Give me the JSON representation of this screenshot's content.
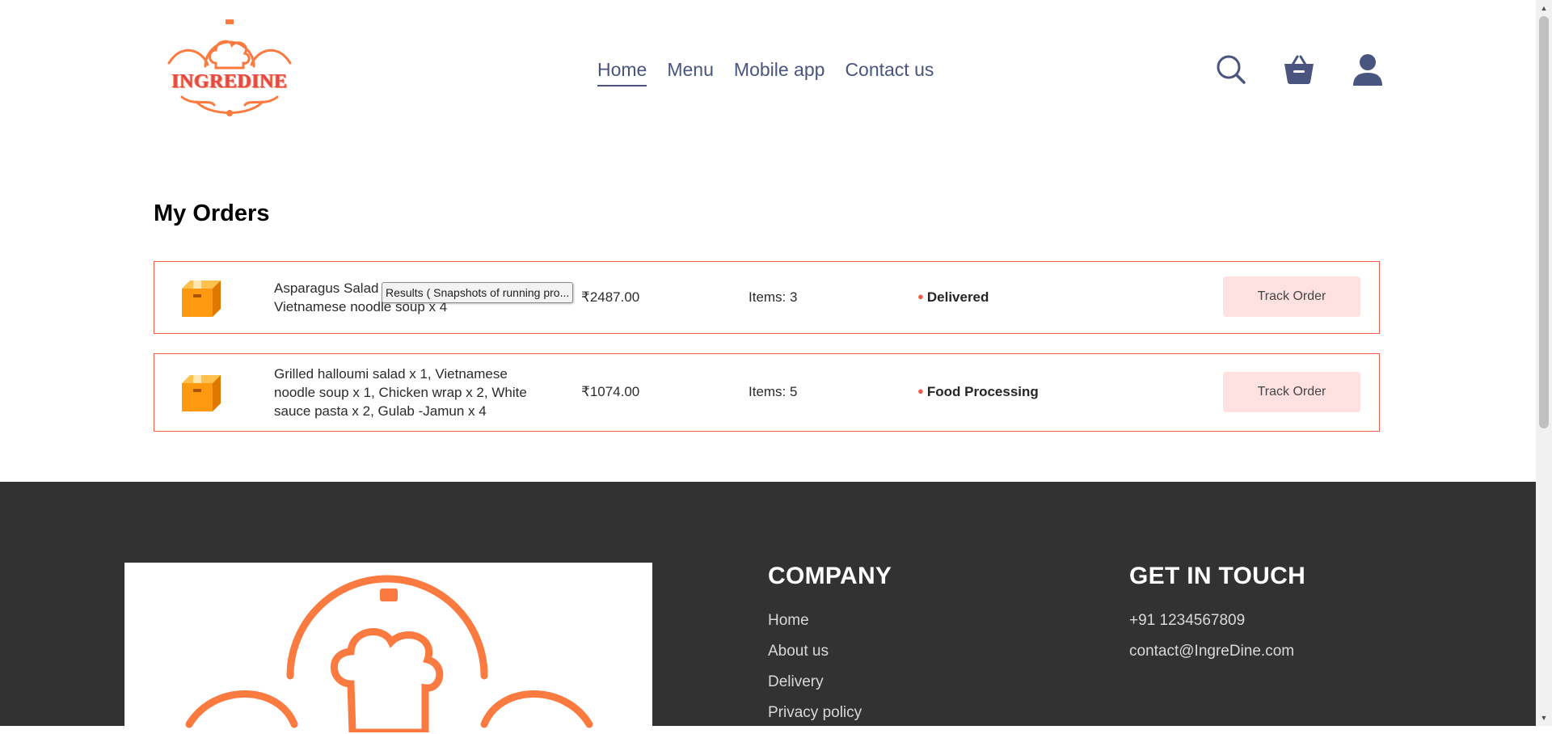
{
  "brand": {
    "logo_text": "INGREDINE"
  },
  "nav": {
    "items": [
      "Home",
      "Menu",
      "Mobile app",
      "Contact us"
    ],
    "active": "Home"
  },
  "header_icons": [
    "search-icon",
    "basket-icon",
    "profile-icon"
  ],
  "main": {
    "title": "My Orders",
    "orders": [
      {
        "items": "Asparagus Salad x 2, Fruit tea x 4, Vietnamese noodle soup x 4",
        "amount": "₹2487.00",
        "count": "Items: 3",
        "status": "Delivered",
        "button": "Track Order"
      },
      {
        "items": "Grilled halloumi salad x 1, Vietnamese noodle soup x 1, Chicken wrap x 2, White sauce pasta x 2, Gulab -Jamun x 4",
        "amount": "₹1074.00",
        "count": "Items: 5",
        "status": "Food Processing",
        "button": "Track Order"
      }
    ]
  },
  "tooltip": "Results ( Snapshots of running pro...",
  "footer": {
    "company": {
      "heading": "COMPANY",
      "links": [
        "Home",
        "About us",
        "Delivery",
        "Privacy policy"
      ]
    },
    "contact": {
      "heading": "GET IN TOUCH",
      "phone": "+91 1234567809",
      "email": "contact@IngreDine.com"
    }
  },
  "colors": {
    "accent": "#f05c4a",
    "nav_text": "#49557e",
    "button_bg": "#ffe1e1",
    "footer_bg": "#323232",
    "logo_orange": "#fb7a3f",
    "parcel_orange": "#ff9910"
  }
}
